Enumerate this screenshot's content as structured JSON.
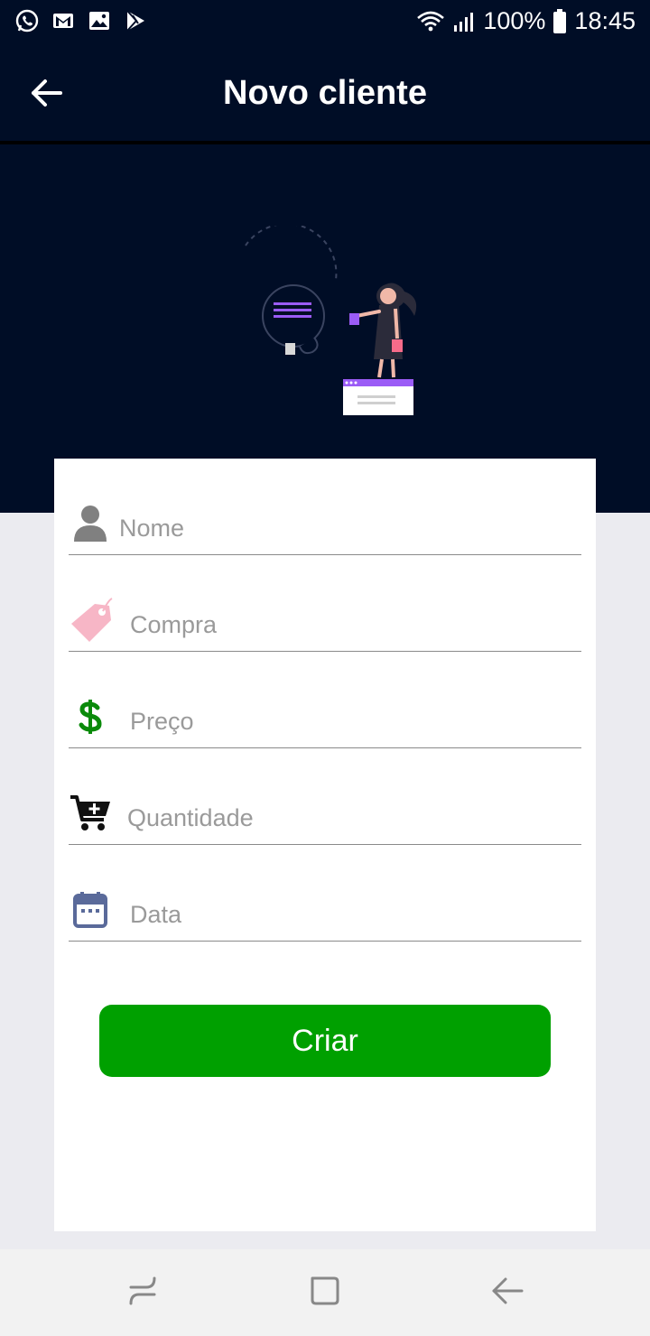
{
  "status_bar": {
    "battery": "100%",
    "time": "18:45",
    "icons": [
      "whatsapp-icon",
      "gmail-icon",
      "gallery-icon",
      "play-store-icon",
      "wifi-icon",
      "signal-icon",
      "battery-icon"
    ]
  },
  "app_bar": {
    "title": "Novo cliente",
    "back_icon": "arrow-left-icon"
  },
  "form": {
    "fields": [
      {
        "icon": "person-icon",
        "placeholder": "Nome",
        "value": ""
      },
      {
        "icon": "price-tag-icon",
        "placeholder": "Compra",
        "value": ""
      },
      {
        "icon": "dollar-icon",
        "placeholder": "Preço",
        "value": ""
      },
      {
        "icon": "cart-add-icon",
        "placeholder": "Quantidade",
        "value": ""
      },
      {
        "icon": "calendar-icon",
        "placeholder": "Data",
        "value": ""
      }
    ],
    "submit_label": "Criar"
  },
  "colors": {
    "header_bg": "#000d26",
    "button_green": "#00a000",
    "page_bg": "#ebebf0",
    "accent_purple": "#9b5cf6",
    "tag_pink": "#f7b6c6",
    "dollar_green": "#0a8a0a",
    "calendar_blue": "#5a6a9a"
  },
  "nav_bar": {
    "icons": [
      "recent-apps-icon",
      "home-icon",
      "back-icon"
    ]
  }
}
